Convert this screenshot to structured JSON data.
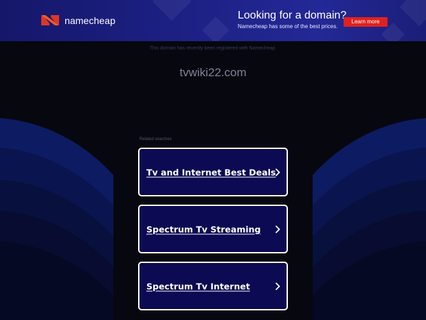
{
  "banner": {
    "brand": "namecheap",
    "promo_title": "Looking for a domain?",
    "promo_subtitle": "Namecheap has some of the best prices.",
    "cta_label": "Learn more",
    "accent_color": "#e0211f",
    "logo_color": "#de3723"
  },
  "notice": "This domain has recently been registered with Namecheap.",
  "domain": "tvwiki22.com",
  "related_heading": "Related searches",
  "links": [
    {
      "label": "Tv and Internet Best Deals",
      "icon": "chevron-right-icon"
    },
    {
      "label": "Spectrum Tv Streaming",
      "icon": "chevron-right-icon"
    },
    {
      "label": "Spectrum Tv Internet",
      "icon": "chevron-right-icon"
    }
  ]
}
